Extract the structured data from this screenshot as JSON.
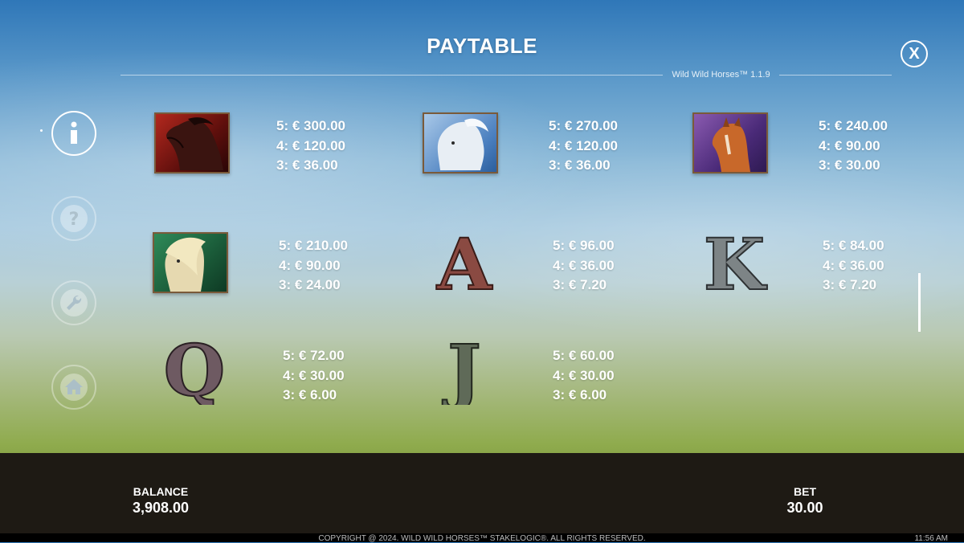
{
  "header": {
    "title": "PAYTABLE",
    "version": "Wild Wild Horses™ 1.1.9"
  },
  "nav": [
    {
      "name": "info",
      "icon": "info-icon",
      "active": true
    },
    {
      "name": "help",
      "icon": "question-icon",
      "active": false
    },
    {
      "name": "settings",
      "icon": "wrench-icon",
      "active": false
    },
    {
      "name": "home",
      "icon": "home-icon",
      "active": false
    }
  ],
  "symbols": [
    {
      "name": "red-horse",
      "pays": [
        "5: € 300.00",
        "4: € 120.00",
        "3: € 36.00"
      ]
    },
    {
      "name": "white-horse",
      "pays": [
        "5: € 270.00",
        "4: € 120.00",
        "3: € 36.00"
      ]
    },
    {
      "name": "chestnut-horse",
      "pays": [
        "5: € 240.00",
        "4: € 90.00",
        "3: € 30.00"
      ]
    },
    {
      "name": "palomino-horse",
      "pays": [
        "5: € 210.00",
        "4: € 90.00",
        "3: € 24.00"
      ]
    },
    {
      "name": "letter-a",
      "letter": "A",
      "pays": [
        "5: € 96.00",
        "4: € 36.00",
        "3: € 7.20"
      ]
    },
    {
      "name": "letter-k",
      "letter": "K",
      "pays": [
        "5: € 84.00",
        "4: € 36.00",
        "3: € 7.20"
      ]
    },
    {
      "name": "letter-q",
      "letter": "Q",
      "pays": [
        "5: € 72.00",
        "4: € 30.00",
        "3: € 6.00"
      ]
    },
    {
      "name": "letter-j",
      "letter": "J",
      "pays": [
        "5: € 60.00",
        "4: € 30.00",
        "3: € 6.00"
      ]
    }
  ],
  "footer": {
    "balance_label": "BALANCE",
    "balance_value": "3,908.00",
    "bet_label": "BET",
    "bet_value": "30.00",
    "copyright": "COPYRIGHT @ 2024. WILD WILD HORSES™ STAKELOGIC®. ALL RIGHTS RESERVED.",
    "clock": "11:56 AM"
  },
  "colors": {
    "letter_a": "#8a4a42",
    "letter_k": "#7d8486",
    "letter_q": "#6e5a62",
    "letter_j": "#5f6a58"
  }
}
